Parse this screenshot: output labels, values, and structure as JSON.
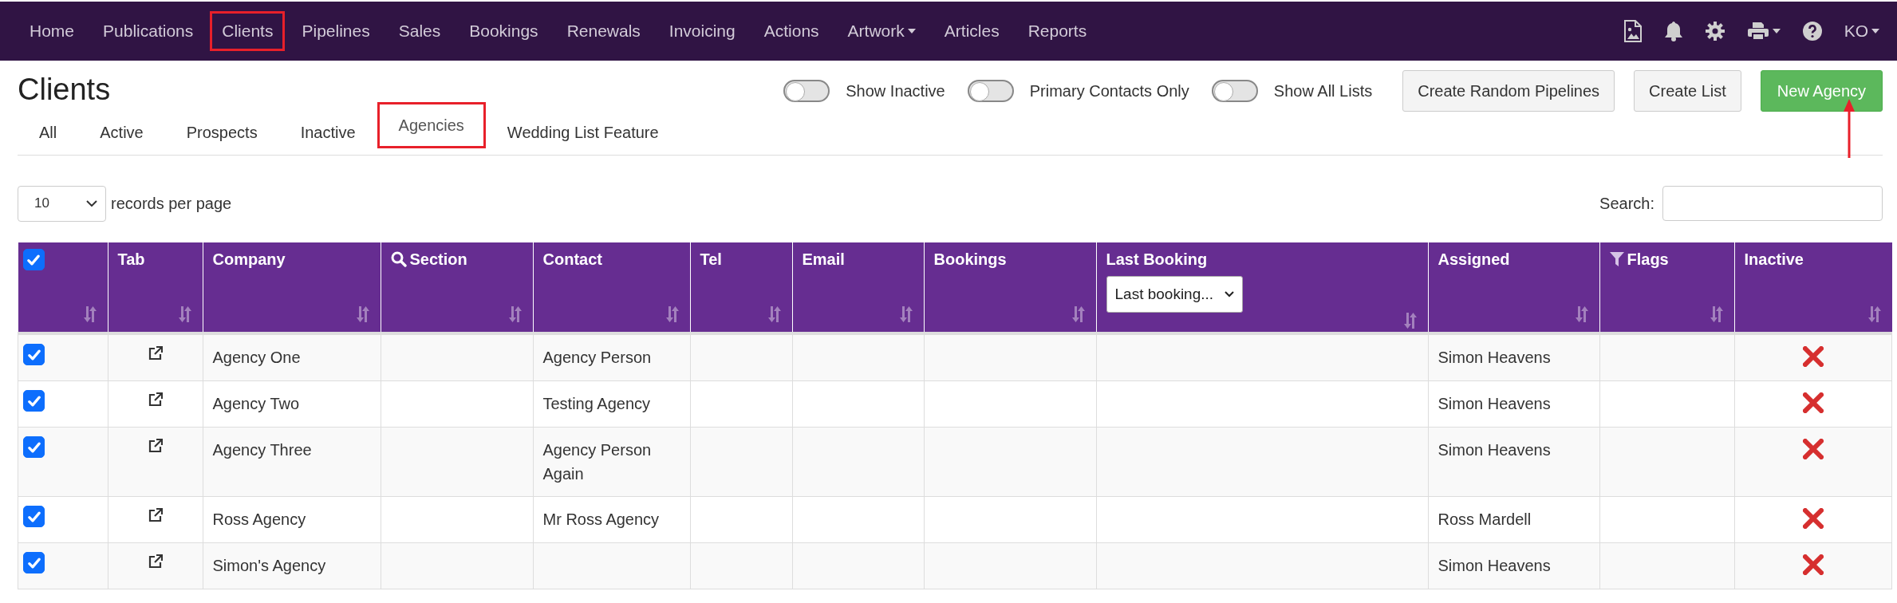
{
  "navbar": {
    "items": [
      {
        "label": "Home",
        "highlighted": false,
        "dropdown": false
      },
      {
        "label": "Publications",
        "highlighted": false,
        "dropdown": false
      },
      {
        "label": "Clients",
        "highlighted": true,
        "dropdown": false
      },
      {
        "label": "Pipelines",
        "highlighted": false,
        "dropdown": false
      },
      {
        "label": "Sales",
        "highlighted": false,
        "dropdown": false
      },
      {
        "label": "Bookings",
        "highlighted": false,
        "dropdown": false
      },
      {
        "label": "Renewals",
        "highlighted": false,
        "dropdown": false
      },
      {
        "label": "Invoicing",
        "highlighted": false,
        "dropdown": false
      },
      {
        "label": "Actions",
        "highlighted": false,
        "dropdown": false
      },
      {
        "label": "Artwork",
        "highlighted": false,
        "dropdown": true
      },
      {
        "label": "Articles",
        "highlighted": false,
        "dropdown": false
      },
      {
        "label": "Reports",
        "highlighted": false,
        "dropdown": false
      }
    ],
    "user": "KO"
  },
  "header": {
    "title": "Clients",
    "toggles": [
      {
        "label": "Show Inactive",
        "on": false
      },
      {
        "label": "Primary Contacts Only",
        "on": false
      },
      {
        "label": "Show All Lists",
        "on": false
      }
    ],
    "buttons": [
      {
        "label": "Create Random Pipelines",
        "kind": "default"
      },
      {
        "label": "Create List",
        "kind": "default"
      },
      {
        "label": "New Agency",
        "kind": "success"
      }
    ]
  },
  "tabs": [
    {
      "label": "All",
      "selected": false,
      "highlighted": false
    },
    {
      "label": "Active",
      "selected": false,
      "highlighted": false
    },
    {
      "label": "Prospects",
      "selected": false,
      "highlighted": false
    },
    {
      "label": "Inactive",
      "selected": false,
      "highlighted": false
    },
    {
      "label": "Agencies",
      "selected": true,
      "highlighted": true
    },
    {
      "label": "Wedding List Feature",
      "selected": false,
      "highlighted": false
    }
  ],
  "length_menu": {
    "value": "10",
    "label": "records per page"
  },
  "search": {
    "label": "Search:"
  },
  "table": {
    "columns": [
      {
        "kind": "checkbox",
        "checked": true
      },
      {
        "kind": "text",
        "label": "Tab"
      },
      {
        "kind": "text",
        "label": "Company"
      },
      {
        "kind": "search",
        "label": "Section"
      },
      {
        "kind": "text",
        "label": "Contact"
      },
      {
        "kind": "text",
        "label": "Tel"
      },
      {
        "kind": "text",
        "label": "Email"
      },
      {
        "kind": "text",
        "label": "Bookings"
      },
      {
        "kind": "select",
        "label": "Last Booking",
        "value": "Last booking..."
      },
      {
        "kind": "text",
        "label": "Assigned"
      },
      {
        "kind": "filter",
        "label": "Flags"
      },
      {
        "kind": "text",
        "label": "Inactive"
      }
    ],
    "rows": [
      {
        "checked": true,
        "company": "Agency One",
        "contact": "Agency Person",
        "assigned": "Simon Heavens",
        "inactive": false
      },
      {
        "checked": true,
        "company": "Agency Two",
        "contact": "Testing Agency",
        "assigned": "Simon Heavens",
        "inactive": false
      },
      {
        "checked": true,
        "company": "Agency Three",
        "contact": "Agency Person Again",
        "assigned": "Simon Heavens",
        "inactive": false
      },
      {
        "checked": true,
        "company": "Ross Agency",
        "contact": "Mr Ross Agency",
        "assigned": "Ross Mardell",
        "inactive": false
      },
      {
        "checked": true,
        "company": "Simon's Agency",
        "assigned": "Simon Heavens",
        "inactive": false
      }
    ]
  }
}
